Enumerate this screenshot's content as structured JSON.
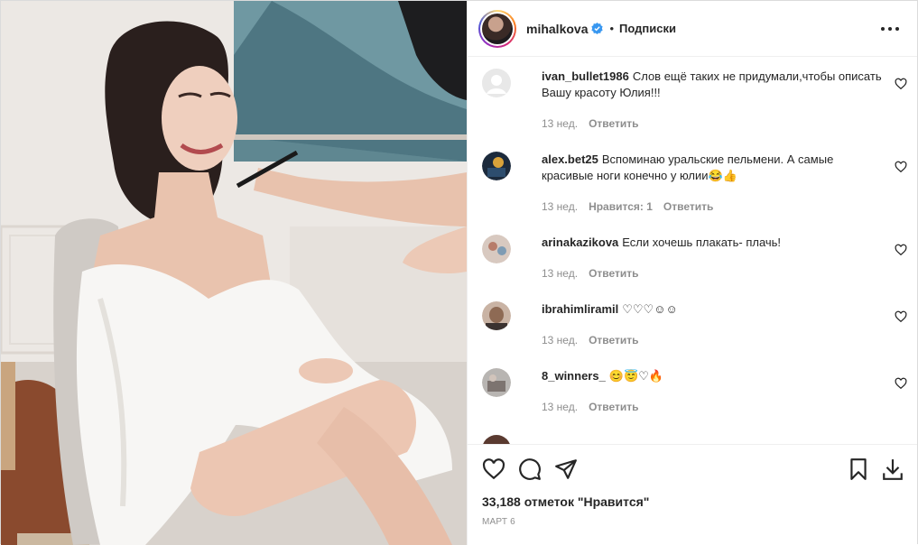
{
  "post": {
    "author": {
      "username": "mihalkova",
      "verified": true,
      "separator": "•",
      "follow_label": "Подписки"
    },
    "comments": [
      {
        "username": "ivan_bullet1986",
        "text": "Слов ещё таких не придумали,чтобы описать Вашу красоту Юлия!!!",
        "time": "13 нед.",
        "likes": "",
        "reply_label": "Ответить"
      },
      {
        "username": "alex.bet25",
        "text": "Вспоминаю уральские пельмени. А самые красивые ноги конечно у юлии😂👍",
        "time": "13 нед.",
        "likes": "Нравится: 1",
        "reply_label": "Ответить"
      },
      {
        "username": "arinakazikova",
        "text": "Если хочешь плакать- плачь!",
        "time": "13 нед.",
        "likes": "",
        "reply_label": "Ответить"
      },
      {
        "username": "ibrahimliramil",
        "text": "♡♡♡☺☺",
        "time": "13 нед.",
        "likes": "",
        "reply_label": "Ответить"
      },
      {
        "username": "8_winners_",
        "text": "😊😇♡🔥",
        "time": "13 нед.",
        "likes": "",
        "reply_label": "Ответить"
      }
    ],
    "likes_text": "33,188 отметок \"Нравится\"",
    "date": "МАРТ 6"
  },
  "icons": {
    "more": "more-dots-icon",
    "heart": "heart-icon",
    "comment": "comment-icon",
    "share": "share-icon",
    "save": "bookmark-icon",
    "download": "download-icon",
    "verified": "verified-badge-icon"
  },
  "colors": {
    "verified": "#3897f0",
    "text": "#262626",
    "muted": "#8e8e8e",
    "border": "#efefef"
  }
}
